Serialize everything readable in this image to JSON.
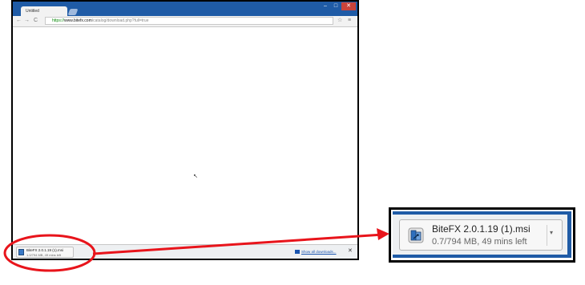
{
  "browser": {
    "tab_title": "Untitled",
    "url": {
      "scheme": "https://",
      "host": "www.bitefx.com",
      "path": "/catalog/download.php?full=true"
    },
    "window_controls": {
      "minimize": "–",
      "maximize": "□",
      "close": "✕"
    },
    "nav_icons": {
      "back": "←",
      "forward": "→",
      "reload": "C"
    },
    "omnibox_icons": {
      "star": "☆",
      "menu": "≡"
    }
  },
  "download_shelf": {
    "item": {
      "filename": "BiteFX 2.0.1.19 (1).msi",
      "status": "1.0/794 MB, 49 mins left"
    },
    "show_all_label": "Show all downloads...",
    "close_glyph": "✕"
  },
  "zoomed_item": {
    "filename": "BiteFX 2.0.1.19 (1).msi",
    "status": "0.7/794 MB, 49 mins left",
    "menu_glyph": "▾"
  },
  "colors": {
    "window_frame": "#1f5ba6",
    "annotation": "#e8141b"
  }
}
